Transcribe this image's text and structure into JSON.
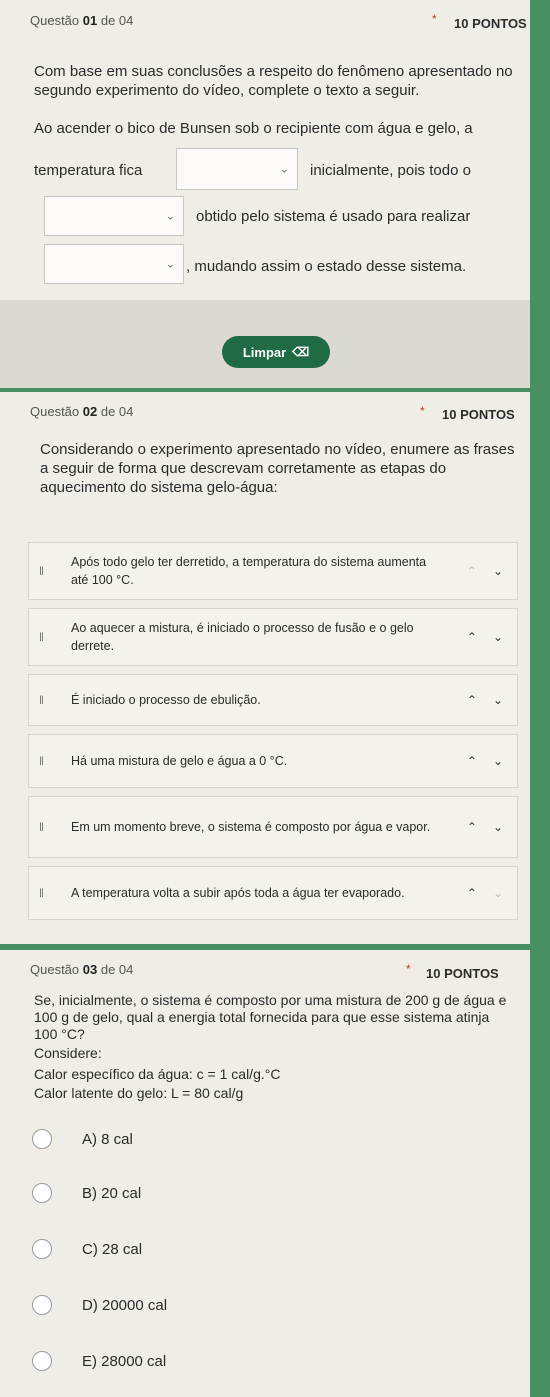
{
  "q1": {
    "label_prefix": "Questão ",
    "number": "01",
    "of": " de 04",
    "points": "10 PONTOS",
    "prompt": "Com base em suas conclusões a respeito do fenômeno apresentado no segundo experimento do vídeo, complete o texto a seguir.",
    "line1": "Ao acender o bico de Bunsen sob o recipiente com água e gelo, a",
    "line2_a": "temperatura fica",
    "line2_b": "inicialmente, pois todo o",
    "line3": "obtido pelo sistema é usado para realizar",
    "line4": ", mudando assim o estado desse sistema.",
    "clear_label": "Limpar"
  },
  "q2": {
    "label_prefix": "Questão ",
    "number": "02",
    "of": " de 04",
    "points": "10 PONTOS",
    "prompt": "Considerando o experimento apresentado no vídeo, enumere as frases a seguir de forma que descrevam corretamente as etapas do aquecimento do sistema gelo-água:",
    "items": [
      "Após todo gelo ter derretido, a temperatura do sistema aumenta até 100 °C.",
      "Ao aquecer a mistura, é iniciado o processo de fusão e o gelo derrete.",
      "É iniciado o processo de ebulição.",
      "Há uma mistura de gelo e água a 0 °C.",
      "Em um momento breve, o sistema é composto por água e vapor.",
      "A temperatura volta a subir após toda a água ter evaporado."
    ]
  },
  "q3": {
    "label_prefix": "Questão ",
    "number": "03",
    "of": " de 04",
    "points": "10 PONTOS",
    "prompt": "Se, inicialmente, o sistema é composto por uma mistura de 200 g de água e 100 g de gelo, qual a energia total fornecida para que esse sistema atinja 100 °C?",
    "considere": "Considere:",
    "c_line": "Calor específico da água: c = 1 cal/g.°C",
    "l_line": "Calor latente do gelo: L = 80 cal/g",
    "options": [
      "A) 8 cal",
      "B) 20 cal",
      "C) 28 cal",
      "D) 20000 cal",
      "E) 28000 cal"
    ]
  },
  "colors": {
    "background": "#4a8f63",
    "card": "#f0ede6",
    "button": "#1f6b45",
    "required_star": "#c0392b"
  },
  "icons": {
    "dropdown": "chevron-down-icon",
    "clear": "eraser-icon",
    "drag": "drag-handle-icon",
    "up": "chevron-up-icon",
    "down": "chevron-down-icon",
    "radio": "radio-icon"
  }
}
